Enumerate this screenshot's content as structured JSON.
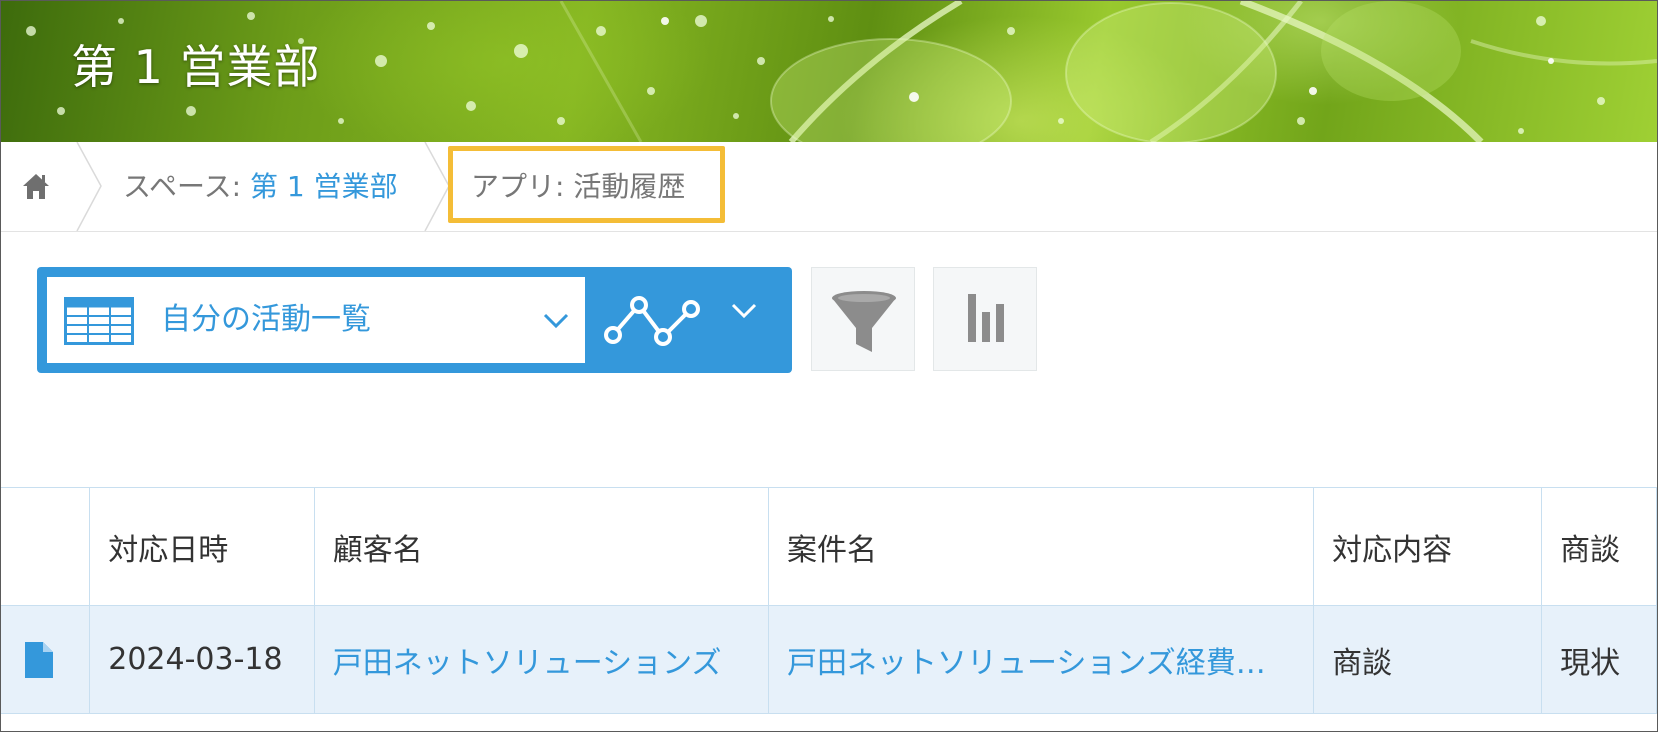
{
  "header": {
    "space_title": "第 1 営業部"
  },
  "breadcrumb": {
    "home_icon": "home-icon",
    "space_prefix": "スペース: ",
    "space_name": "第 1 営業部",
    "app_prefix": "アプリ: ",
    "app_name": "活動履歴",
    "highlight_color": "#f4bd37"
  },
  "toolbar": {
    "view_name": "自分の活動一覧",
    "view_icon": "table-view-icon",
    "graph_icon": "graph-icon",
    "filter_icon": "filter-icon",
    "chart_icon": "bar-chart-icon"
  },
  "table": {
    "columns": [
      "",
      "対応日時",
      "顧客名",
      "案件名",
      "対応内容",
      "商談"
    ],
    "rows": [
      {
        "icon": "record-detail-icon",
        "date": "2024-03-18",
        "customer": "戸田ネットソリューションズ",
        "deal": "戸田ネットソリューションズ経費…",
        "activity": "商談",
        "status": "現状"
      }
    ]
  },
  "colors": {
    "accent": "#3498db",
    "row_highlight": "#e7f1fa",
    "grid_line": "#c8dff0"
  }
}
